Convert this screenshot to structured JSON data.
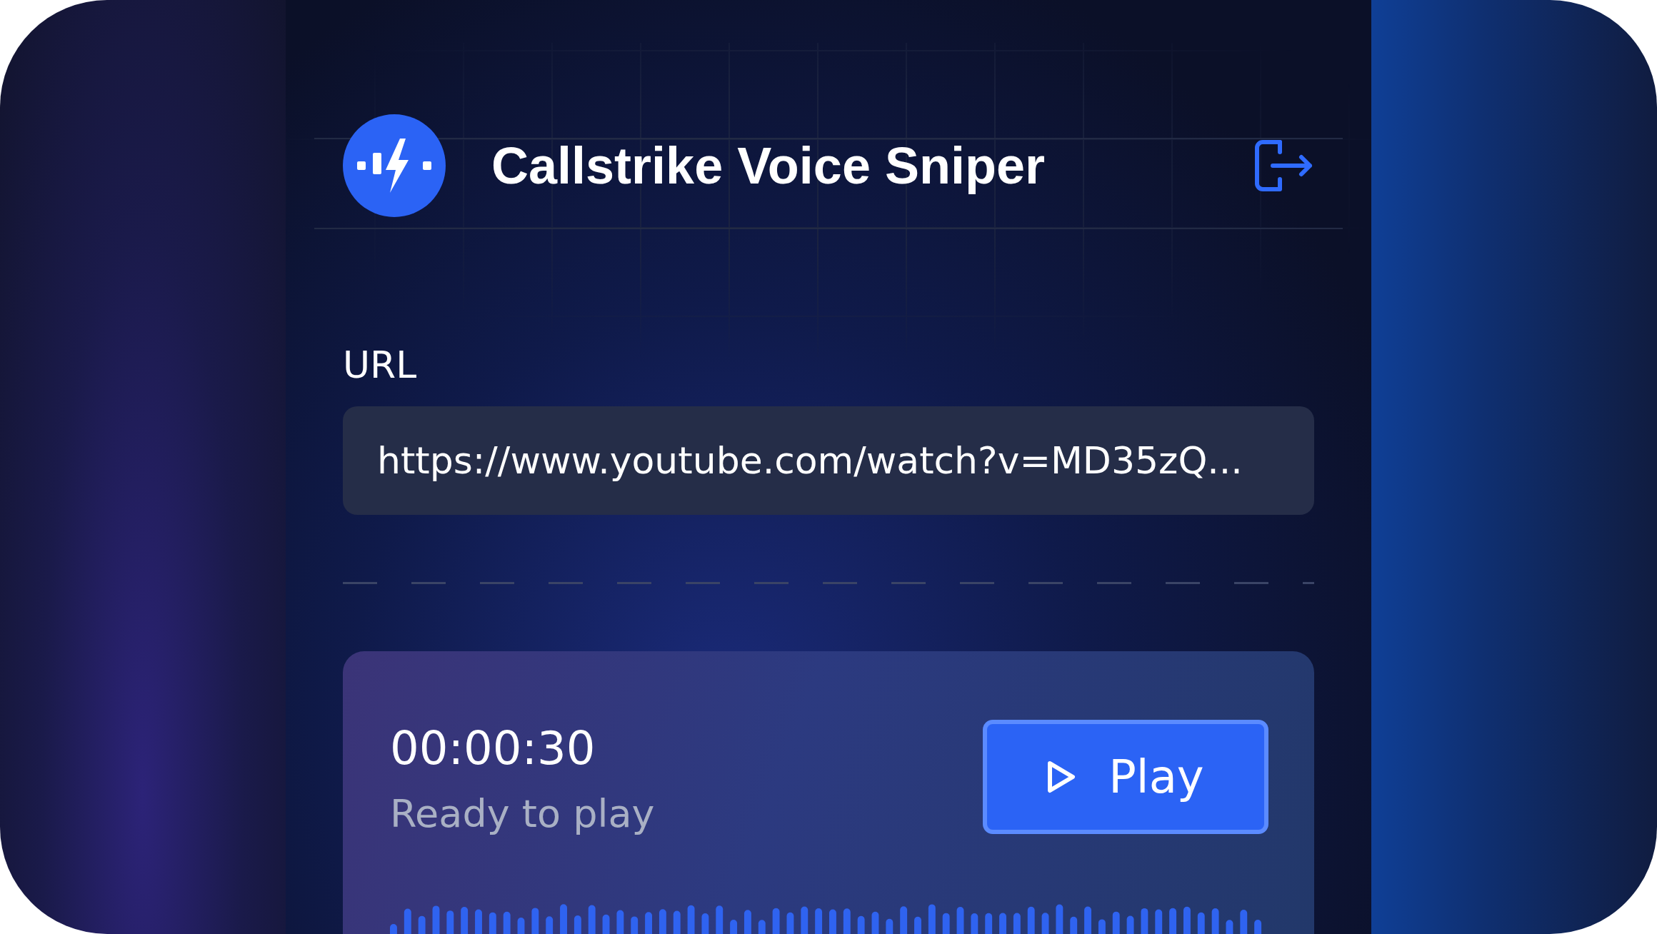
{
  "app": {
    "title": "Callstrike Voice Sniper"
  },
  "url_field": {
    "label": "URL",
    "value": "https://www.youtube.com/watch?v=MD35zQ..."
  },
  "player": {
    "time": "00:00:30",
    "status": "Ready to play",
    "play_button": {
      "label": "Play"
    }
  }
}
